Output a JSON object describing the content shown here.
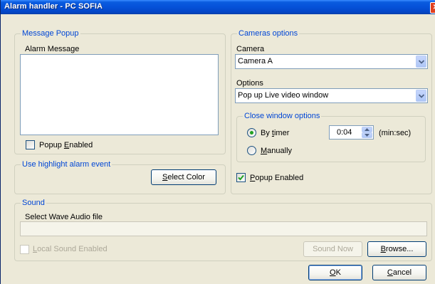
{
  "window": {
    "title": "Alarm handler - PC SOFIA",
    "close_glyph": "✕"
  },
  "message_popup": {
    "legend": "Message Popup",
    "alarm_message_label": "Alarm Message",
    "alarm_message_value": "",
    "popup_enabled": {
      "pre": "Popup ",
      "ul": "E",
      "post": "nabled",
      "checked": false
    }
  },
  "highlight": {
    "legend": "Use highlight alarm event",
    "select_color": {
      "pre": "",
      "ul": "S",
      "post": "elect Color"
    }
  },
  "cameras": {
    "legend": "Cameras options",
    "camera_label": "Camera",
    "camera_value": "Camera A",
    "options_label": "Options",
    "options_value": "Pop up Live video window",
    "close_window": {
      "legend": "Close window options",
      "by_timer": {
        "pre": "By ",
        "ul": "t",
        "post": "imer",
        "selected": true
      },
      "manually": {
        "pre": "",
        "ul": "M",
        "post": "anually",
        "selected": false
      },
      "timer_value": "0:04",
      "timer_unit": "(min:sec)"
    },
    "popup_enabled": {
      "pre": "",
      "ul": "P",
      "post": "opup Enabled",
      "checked": true
    }
  },
  "sound": {
    "legend": "Sound",
    "wave_label": "Select Wave Audio file",
    "wave_value": "",
    "local_sound": {
      "pre": "",
      "ul": "L",
      "post": "ocal Sound Enabled",
      "checked": false,
      "enabled": false
    },
    "sound_now": "Sound Now",
    "browse": {
      "pre": "",
      "ul": "B",
      "post": "rowse..."
    }
  },
  "dialog_buttons": {
    "ok": {
      "pre": "",
      "ul": "O",
      "post": "K"
    },
    "cancel": {
      "pre": "",
      "ul": "C",
      "post": "ancel"
    }
  }
}
